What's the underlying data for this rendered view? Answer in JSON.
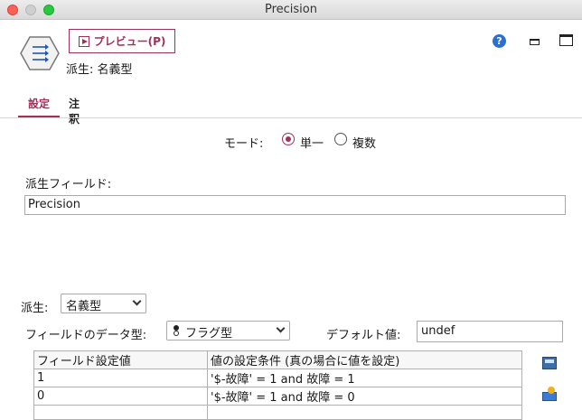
{
  "window": {
    "title": "Precision"
  },
  "header": {
    "preview_button": "プレビュー(P)",
    "node_subtitle": "派生: 名義型",
    "help_glyph": "?"
  },
  "tabs": [
    {
      "label": "設定",
      "active": true
    },
    {
      "label": "注釈",
      "active": false
    }
  ],
  "mode": {
    "label": "モード:",
    "options": [
      {
        "label": "単一",
        "selected": true
      },
      {
        "label": "複数",
        "selected": false
      }
    ]
  },
  "derive_field": {
    "label": "派生フィールド:",
    "value": "Precision"
  },
  "derive_as": {
    "label": "派生:",
    "value": "名義型"
  },
  "field_type": {
    "label": "フィールドのデータ型:",
    "value": "フラグ型"
  },
  "default_value": {
    "label": "デフォルト値:",
    "value": "undef"
  },
  "conditions_table": {
    "columns": [
      "フィールド設定値",
      "値の設定条件 (真の場合に値を設定)"
    ],
    "rows": [
      [
        "1",
        "'$-故障' = 1 and 故障 = 1"
      ],
      [
        "0",
        "'$-故障' = 1 and 故障 = 0"
      ]
    ]
  },
  "icons": {
    "node": "derive-node-icon",
    "help": "help-icon",
    "minimize": "minimize-icon",
    "maximize": "maximize-icon",
    "calculator": "expression-builder-icon",
    "add_rows": "add-rows-icon"
  },
  "colors": {
    "accent": "#a0325a",
    "help_blue": "#2a6fd2"
  }
}
